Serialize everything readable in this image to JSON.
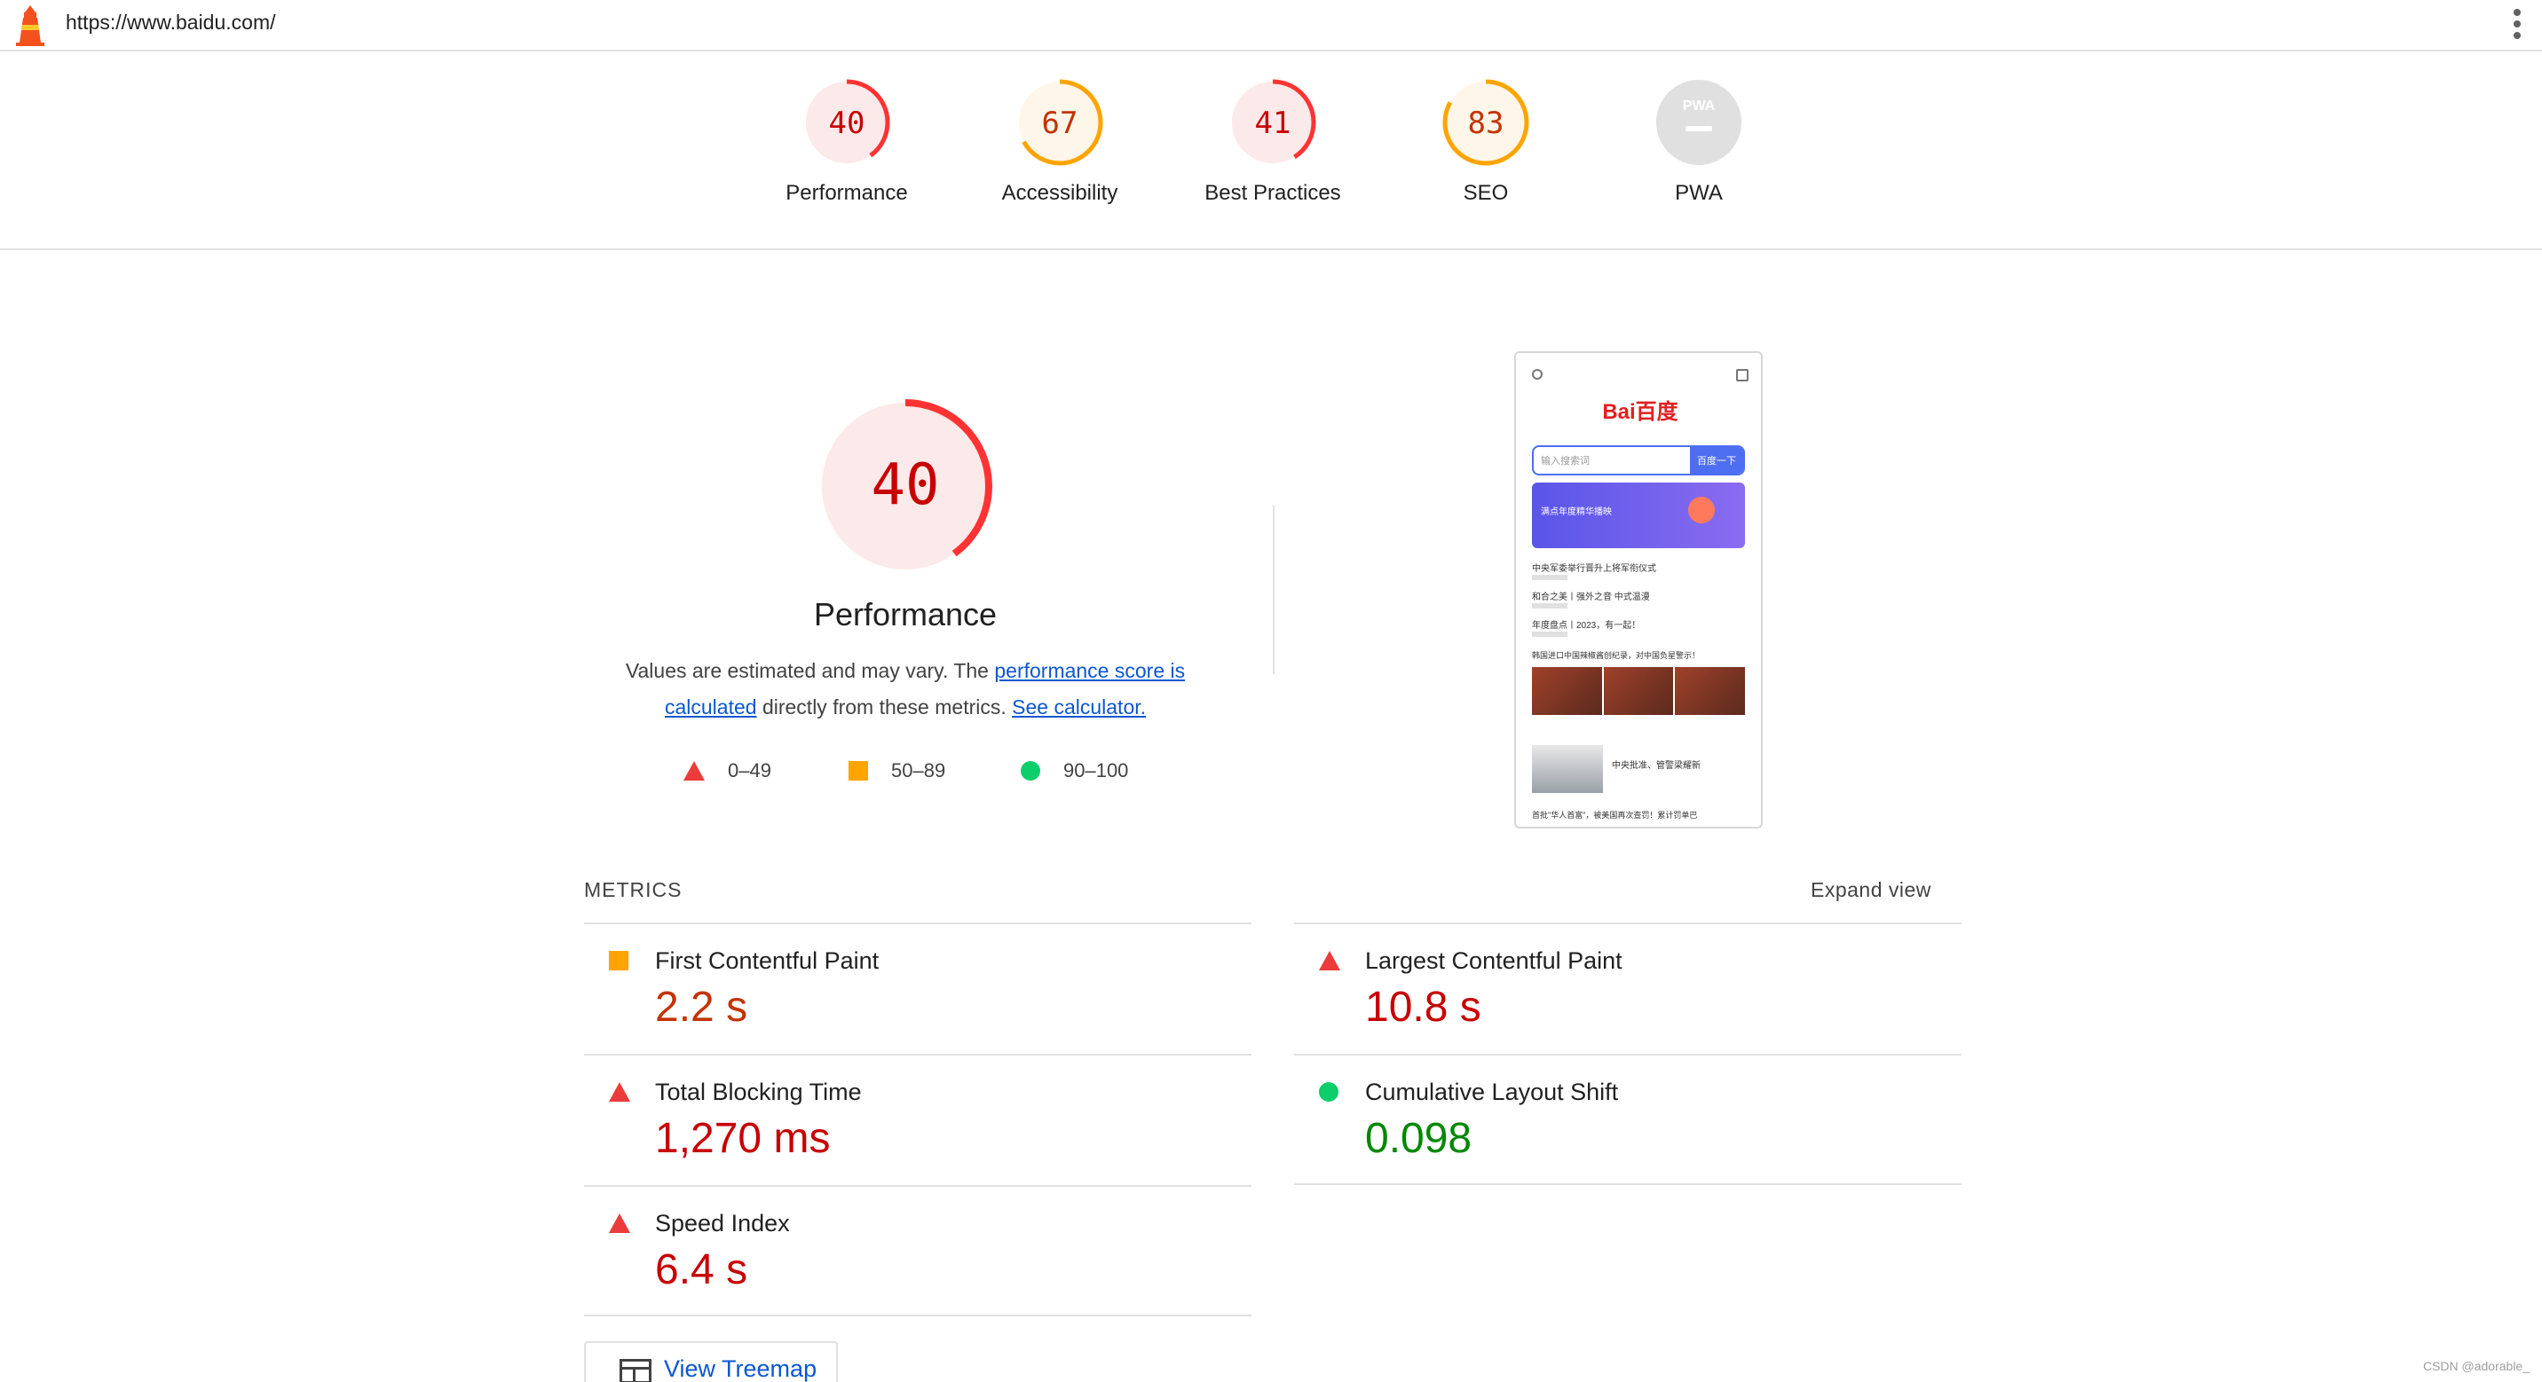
{
  "topbar": {
    "url": "https://www.baidu.com/"
  },
  "gauges": [
    {
      "score": "40",
      "label": "Performance",
      "fraction": 0.4,
      "rating": "fail"
    },
    {
      "score": "67",
      "label": "Accessibility",
      "fraction": 0.67,
      "rating": "average"
    },
    {
      "score": "41",
      "label": "Best Practices",
      "fraction": 0.41,
      "rating": "fail"
    },
    {
      "score": "83",
      "label": "SEO",
      "fraction": 0.83,
      "rating": "average"
    },
    {
      "score": "",
      "label": "PWA",
      "fraction": 0,
      "rating": "pwa",
      "badge": "PWA"
    }
  ],
  "performance": {
    "score": "40",
    "fraction": 0.4,
    "title": "Performance",
    "desc_prefix": "Values are estimated and may vary. The ",
    "link_score": "performance score is calculated",
    "desc_middle": " directly from these metrics. ",
    "link_calc": "See calculator."
  },
  "legend": [
    {
      "range": "0–49",
      "shape": "triangle",
      "color": "#eb3b3b"
    },
    {
      "range": "50–89",
      "shape": "square",
      "color": "#ffa400"
    },
    {
      "range": "90–100",
      "shape": "circle",
      "color": "#0cce6b"
    }
  ],
  "screenshot": {
    "logo": "Bai百度",
    "search_placeholder": "输入搜索词",
    "search_button": "百度一下",
    "banner_text": "满点年度精华播映",
    "news": [
      "中央军委举行晋升上将军衔仪式",
      "和合之美丨强外之音 中式温漫",
      "年度盘点丨2023，有一起！",
      "韩国进口中国辣椒酱创纪录，对中国负星警示！",
      "中央批准、管警梁耀新",
      "首批\"华人首富\"，被美国再次查罚！累计罚单巴"
    ]
  },
  "metrics": {
    "header": "METRICS",
    "expand": "Expand view",
    "items": [
      {
        "name": "First Contentful Paint",
        "value": "2.2 s",
        "rating": "average"
      },
      {
        "name": "Largest Contentful Paint",
        "value": "10.8 s",
        "rating": "fail"
      },
      {
        "name": "Total Blocking Time",
        "value": "1,270 ms",
        "rating": "fail"
      },
      {
        "name": "Cumulative Layout Shift",
        "value": "0.098",
        "rating": "pass"
      },
      {
        "name": "Speed Index",
        "value": "6.4 s",
        "rating": "fail"
      }
    ]
  },
  "treemap": {
    "label": "View Treemap"
  },
  "watermark": "CSDN @adorable_",
  "colors": {
    "fail_stroke": "#ff3333",
    "fail_bg": "#fce9e9",
    "fail_text": "#c70000",
    "average_stroke": "#ffa400",
    "average_bg": "#fff6ea",
    "average_text": "#c33300",
    "pass_text": "#008800",
    "link": "#0b57d0"
  }
}
